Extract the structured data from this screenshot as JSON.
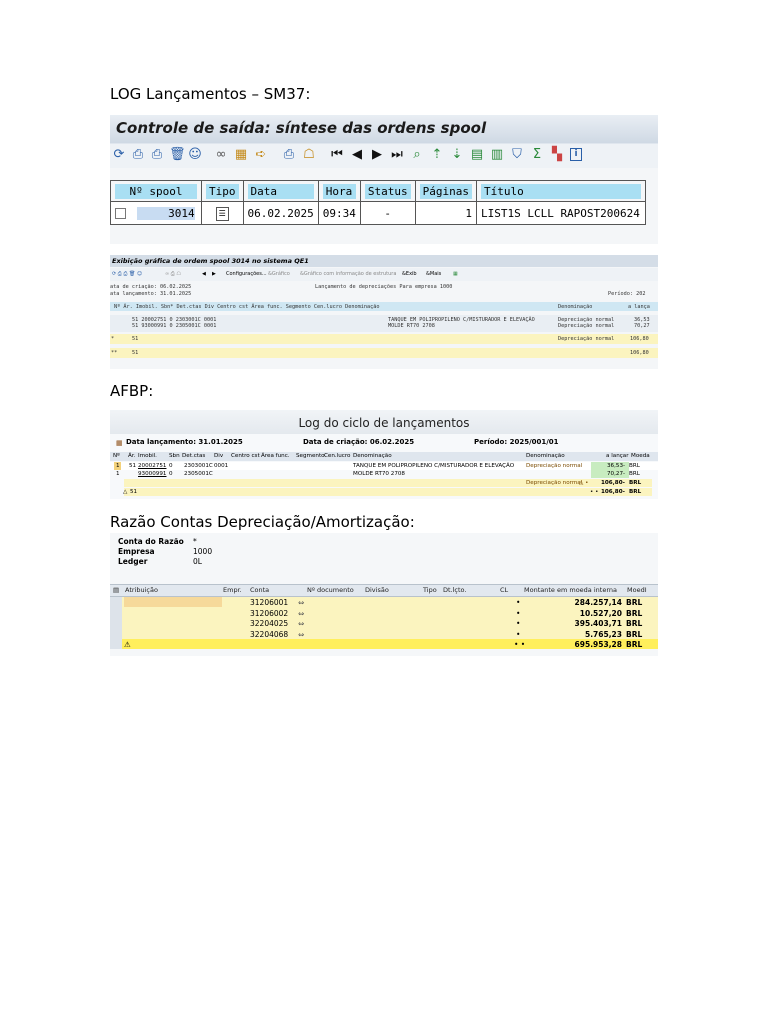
{
  "headings": {
    "sm37": "LOG Lançamentos – SM37:",
    "afbp": "AFBP:",
    "razao": "Razão Contas Depreciação/Amortização:"
  },
  "sm37": {
    "title": "Controle de saída: síntese das ordens spool",
    "columns": [
      "Nº spool",
      "Tipo",
      "Data",
      "Hora",
      "Status",
      "Páginas",
      "Título"
    ],
    "row": {
      "spool": "3014",
      "data": "06.02.2025",
      "hora": "09:34",
      "status": "-",
      "paginas": "1",
      "titulo": "LIST1S LCLL RAPOST200624"
    }
  },
  "graphic": {
    "title": "Exibição gráfica de ordem spool 3014 no sistema QE1",
    "toolbar": {
      "config": "Configurações...",
      "grafico": "Gráfico",
      "grafico_estrutura": "Gráfico com informação de estrutura",
      "exib": "Exib",
      "mais": "Mais"
    },
    "info": {
      "data_criacao_label": "ata de criação:",
      "data_criacao": "06.02.2025",
      "data_lancamento_label": "ata lançamento:",
      "data_lancamento": "31.01.2025",
      "center": "Lançamento de depreciações Para empresa 1000",
      "periodo": "Período: 202"
    },
    "header": "Nº Ár. Imobil.  Sbn* Det.ctas Div  Centro cst Área func. Segmento Cen.lucro Denominação",
    "header_right1": "Denominação",
    "header_right2": "a lança",
    "rows": [
      {
        "left": "51 20002751 0    2303001C 0001",
        "denom": "TANQUE EM POLIPROPILENO C/MISTURADOR E ELEVAÇÃO",
        "tipo": "Depreciação normal",
        "valor": "36,53"
      },
      {
        "left": "51 93000991 0    2305001C 0001",
        "denom": "MOLDE RT70 2708",
        "tipo": "Depreciação normal",
        "valor": "70,27"
      }
    ],
    "subtotal": {
      "mark": "*",
      "nr": "51",
      "tipo": "Depreciação normal",
      "valor": "106,80"
    },
    "total": {
      "mark": "**",
      "nr": "51",
      "valor": "106,80"
    }
  },
  "afbp": {
    "title": "Log do ciclo de lançamentos",
    "data_lancamento": "Data lançamento: 31.01.2025",
    "data_criacao": "Data de criação: 06.02.2025",
    "periodo": "Período: 2025/001/01",
    "columns": [
      "Nº",
      "Ár.",
      "Imobil.",
      "Sbn",
      "Det.ctas",
      "Div",
      "Centro cst",
      "Área func.",
      "Segmento",
      "Cen.lucro",
      "Denominação",
      "Denominação",
      "a lançar",
      "Moeda"
    ],
    "rows": [
      {
        "n": "1",
        "ar": "51",
        "imob": "20002751",
        "sbn": "0",
        "det": "2303001C",
        "div": "0001",
        "denom": "TANQUE EM POLIPROPILENO C/MISTURADOR E ELEVAÇÃO",
        "tipo": "Depreciação normal",
        "valor": "36,53-",
        "moeda": "BRL"
      },
      {
        "n": "1",
        "ar": "",
        "imob": "93000991",
        "sbn": "0",
        "det": "2305001C",
        "div": "",
        "denom": "MOLDE RT70 2708",
        "tipo": "",
        "valor": "70,27-",
        "moeda": "BRL"
      }
    ],
    "subtotal": {
      "tipo": "Depreciação normal",
      "valor": "106,80-",
      "moeda": "BRL"
    },
    "total": {
      "nr": "51",
      "valor": "106,80-",
      "moeda": "BRL"
    }
  },
  "razao": {
    "conta_label": "Conta do Razão",
    "conta_value": "*",
    "empresa_label": "Empresa",
    "empresa_value": "1000",
    "ledger_label": "Ledger",
    "ledger_value": "0L",
    "columns": [
      "Atribuição",
      "Empr.",
      "Conta",
      "Nº documento",
      "Divisão",
      "Tipo",
      "Dt.lçto.",
      "CL",
      "Montante em moeda interna",
      "MoedI"
    ],
    "rows": [
      {
        "conta": "31206001",
        "montante": "284.257,14",
        "moeda": "BRL"
      },
      {
        "conta": "31206002",
        "montante": "10.527,20",
        "moeda": "BRL"
      },
      {
        "conta": "32204025",
        "montante": "395.403,71",
        "moeda": "BRL"
      },
      {
        "conta": "32204068",
        "montante": "5.765,23",
        "moeda": "BRL"
      }
    ],
    "total": {
      "montante": "695.953,28",
      "moeda": "BRL"
    }
  }
}
